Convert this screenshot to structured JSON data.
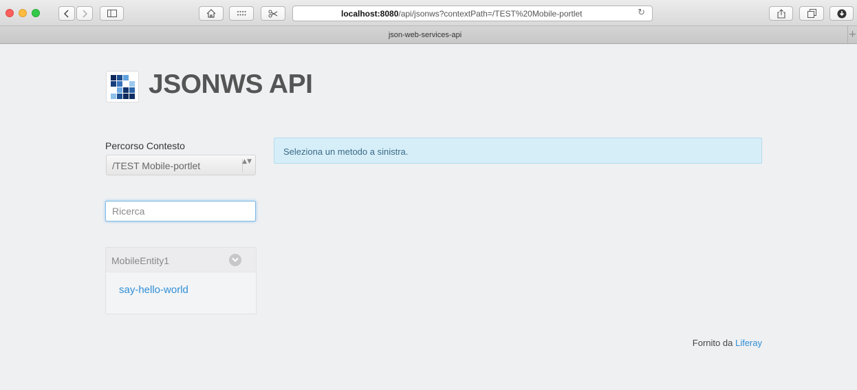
{
  "browser": {
    "url_host": "localhost:8080",
    "url_path": "/api/jsonws?contextPath=/TEST%20Mobile-portlet",
    "tab_title": "json-web-services-api",
    "new_tab_glyph": "+",
    "reload_glyph": "↻"
  },
  "header": {
    "title": "JSONWS API",
    "logo_icon": "liferay-logo-icon"
  },
  "sidebar": {
    "context_label": "Percorso Contesto",
    "context_value": "/TEST Mobile-portlet",
    "context_arrows": "▲▼",
    "search_placeholder": "Ricerca",
    "groups": [
      {
        "title": "MobileEntity1",
        "methods": [
          "say-hello-world"
        ]
      }
    ]
  },
  "main": {
    "alert_text": "Seleziona un metodo a sinistra."
  },
  "footer": {
    "prefix": "Fornito da",
    "link_text": "Liferay"
  },
  "colors": {
    "accent": "#2f8fd6",
    "alert_bg": "#d6eef8",
    "page_bg": "#eff0f2"
  }
}
